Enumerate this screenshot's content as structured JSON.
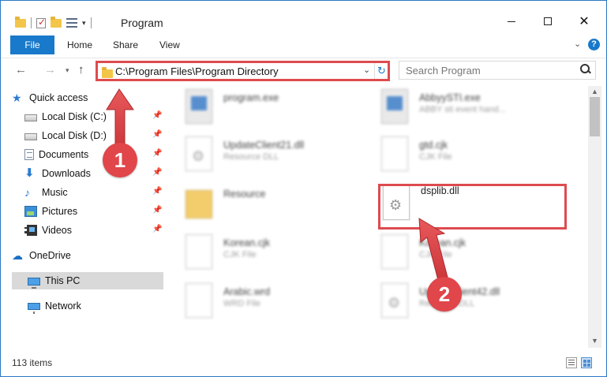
{
  "window": {
    "title": "Program",
    "controls": {
      "minimize": "",
      "maximize": "",
      "close": "✕"
    }
  },
  "ribbon": {
    "tabs": [
      "File",
      "Home",
      "Share",
      "View"
    ],
    "expand": "⌄",
    "help": "?"
  },
  "navigation": {
    "back": "←",
    "forward": "→",
    "recent": "▾",
    "up": "↑",
    "address": "C:\\Program Files\\Program Directory",
    "address_dropdown": "⌄",
    "refresh": "↻",
    "search_placeholder": "Search Program"
  },
  "sidebar": {
    "items": [
      {
        "label": "Quick access",
        "icon": "star-icon",
        "glyph": "★",
        "pinned": false
      },
      {
        "label": "Local Disk (C:)",
        "icon": "disk-icon",
        "glyph": "",
        "pinned": true
      },
      {
        "label": "Local Disk (D:)",
        "icon": "disk-icon",
        "glyph": "",
        "pinned": true
      },
      {
        "label": "Documents",
        "icon": "documents-icon",
        "glyph": "",
        "pinned": true
      },
      {
        "label": "Downloads",
        "icon": "downloads-icon",
        "glyph": "⬇",
        "pinned": true
      },
      {
        "label": "Music",
        "icon": "music-icon",
        "glyph": "♪",
        "pinned": true
      },
      {
        "label": "Pictures",
        "icon": "pictures-icon",
        "glyph": "",
        "pinned": true
      },
      {
        "label": "Videos",
        "icon": "videos-icon",
        "glyph": "",
        "pinned": true
      },
      {
        "label": "OneDrive",
        "icon": "onedrive-icon",
        "glyph": "☁",
        "pinned": false
      },
      {
        "label": "This PC",
        "icon": "this-pc-icon",
        "glyph": "",
        "pinned": false,
        "selected": true
      },
      {
        "label": "Network",
        "icon": "network-icon",
        "glyph": "",
        "pinned": false
      }
    ],
    "pin_glyph": "📌"
  },
  "files": [
    {
      "name": "program.exe",
      "type": "",
      "icon": "exe",
      "blurred": true
    },
    {
      "name": "AbbyySTI.exe",
      "type": "ABBY sti event hand...",
      "icon": "exe",
      "blurred": true
    },
    {
      "name": "UpdateClient21.dll",
      "type": "Resource DLL",
      "icon": "dll",
      "blurred": true
    },
    {
      "name": "gtd.cjk",
      "type": "CJK File",
      "icon": "file",
      "blurred": true
    },
    {
      "name": "Resource",
      "type": "",
      "icon": "folder",
      "blurred": true
    },
    {
      "name": "dsplib.dll",
      "type": "",
      "icon": "dll",
      "blurred": false
    },
    {
      "name": "Korean.cjk",
      "type": "CJK File",
      "icon": "file",
      "blurred": true
    },
    {
      "name": "Korean.cjk",
      "type": "CJK File",
      "icon": "file",
      "blurred": true
    },
    {
      "name": "Arabic.wrd",
      "type": "WRD File",
      "icon": "file",
      "blurred": true
    },
    {
      "name": "UpdateClient42.dll",
      "type": "Resource DLL",
      "icon": "dll",
      "blurred": true
    }
  ],
  "status": {
    "item_count": "113 items"
  },
  "callouts": [
    "1",
    "2"
  ],
  "colors": {
    "accent": "#1979ca",
    "highlight": "#de4b4f",
    "selection": "#d9d9d9"
  }
}
